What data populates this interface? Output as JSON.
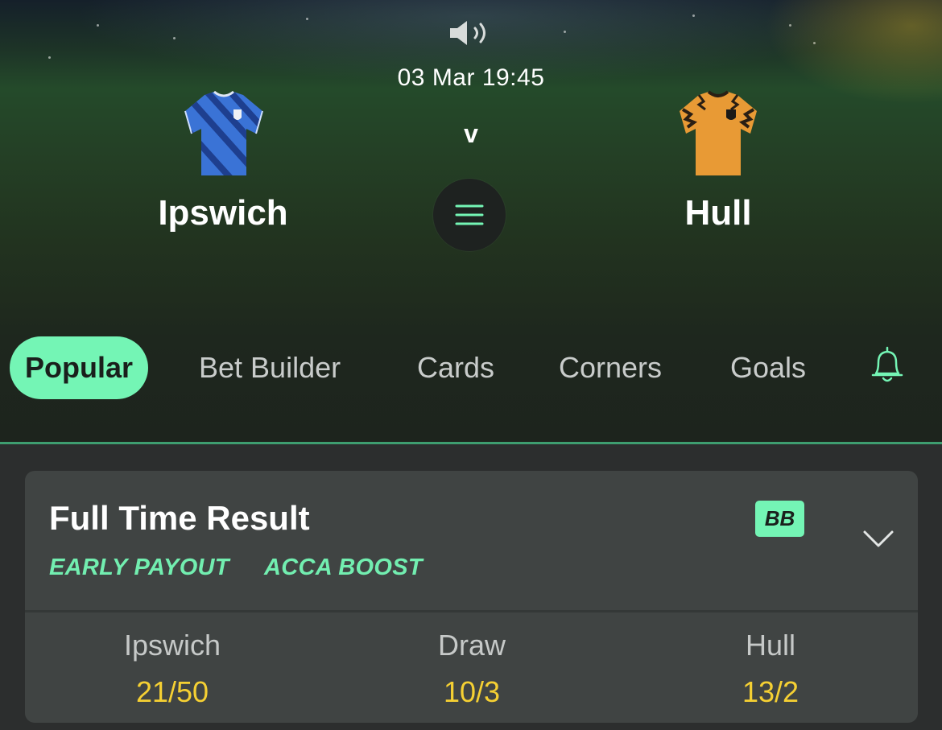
{
  "match": {
    "datetime": "03 Mar 19:45",
    "separator": "v",
    "home": {
      "name": "Ipswich",
      "kit_colors": [
        "#3a73d6",
        "#1e3f8f"
      ]
    },
    "away": {
      "name": "Hull",
      "kit_colors": [
        "#e89a35",
        "#2a1f14"
      ]
    }
  },
  "icons": {
    "sound": "speaker-icon",
    "menu": "hamburger-menu-icon",
    "alerts": "bell-icon",
    "expand": "chevron-down-icon"
  },
  "tabs": [
    {
      "label": "Popular",
      "active": true
    },
    {
      "label": "Bet Builder",
      "active": false
    },
    {
      "label": "Cards",
      "active": false
    },
    {
      "label": "Corners",
      "active": false
    },
    {
      "label": "Goals",
      "active": false
    }
  ],
  "market": {
    "title": "Full Time Result",
    "badge": "BB",
    "tags": [
      "EARLY PAYOUT",
      "ACCA BOOST"
    ],
    "selections": [
      {
        "label": "Ipswich",
        "odds": "21/50"
      },
      {
        "label": "Draw",
        "odds": "10/3"
      },
      {
        "label": "Hull",
        "odds": "13/2"
      }
    ]
  },
  "colors": {
    "accent": "#74f5b5",
    "odds": "#f5d033",
    "card_bg": "#404443",
    "page_bg": "#2c2e2e"
  }
}
